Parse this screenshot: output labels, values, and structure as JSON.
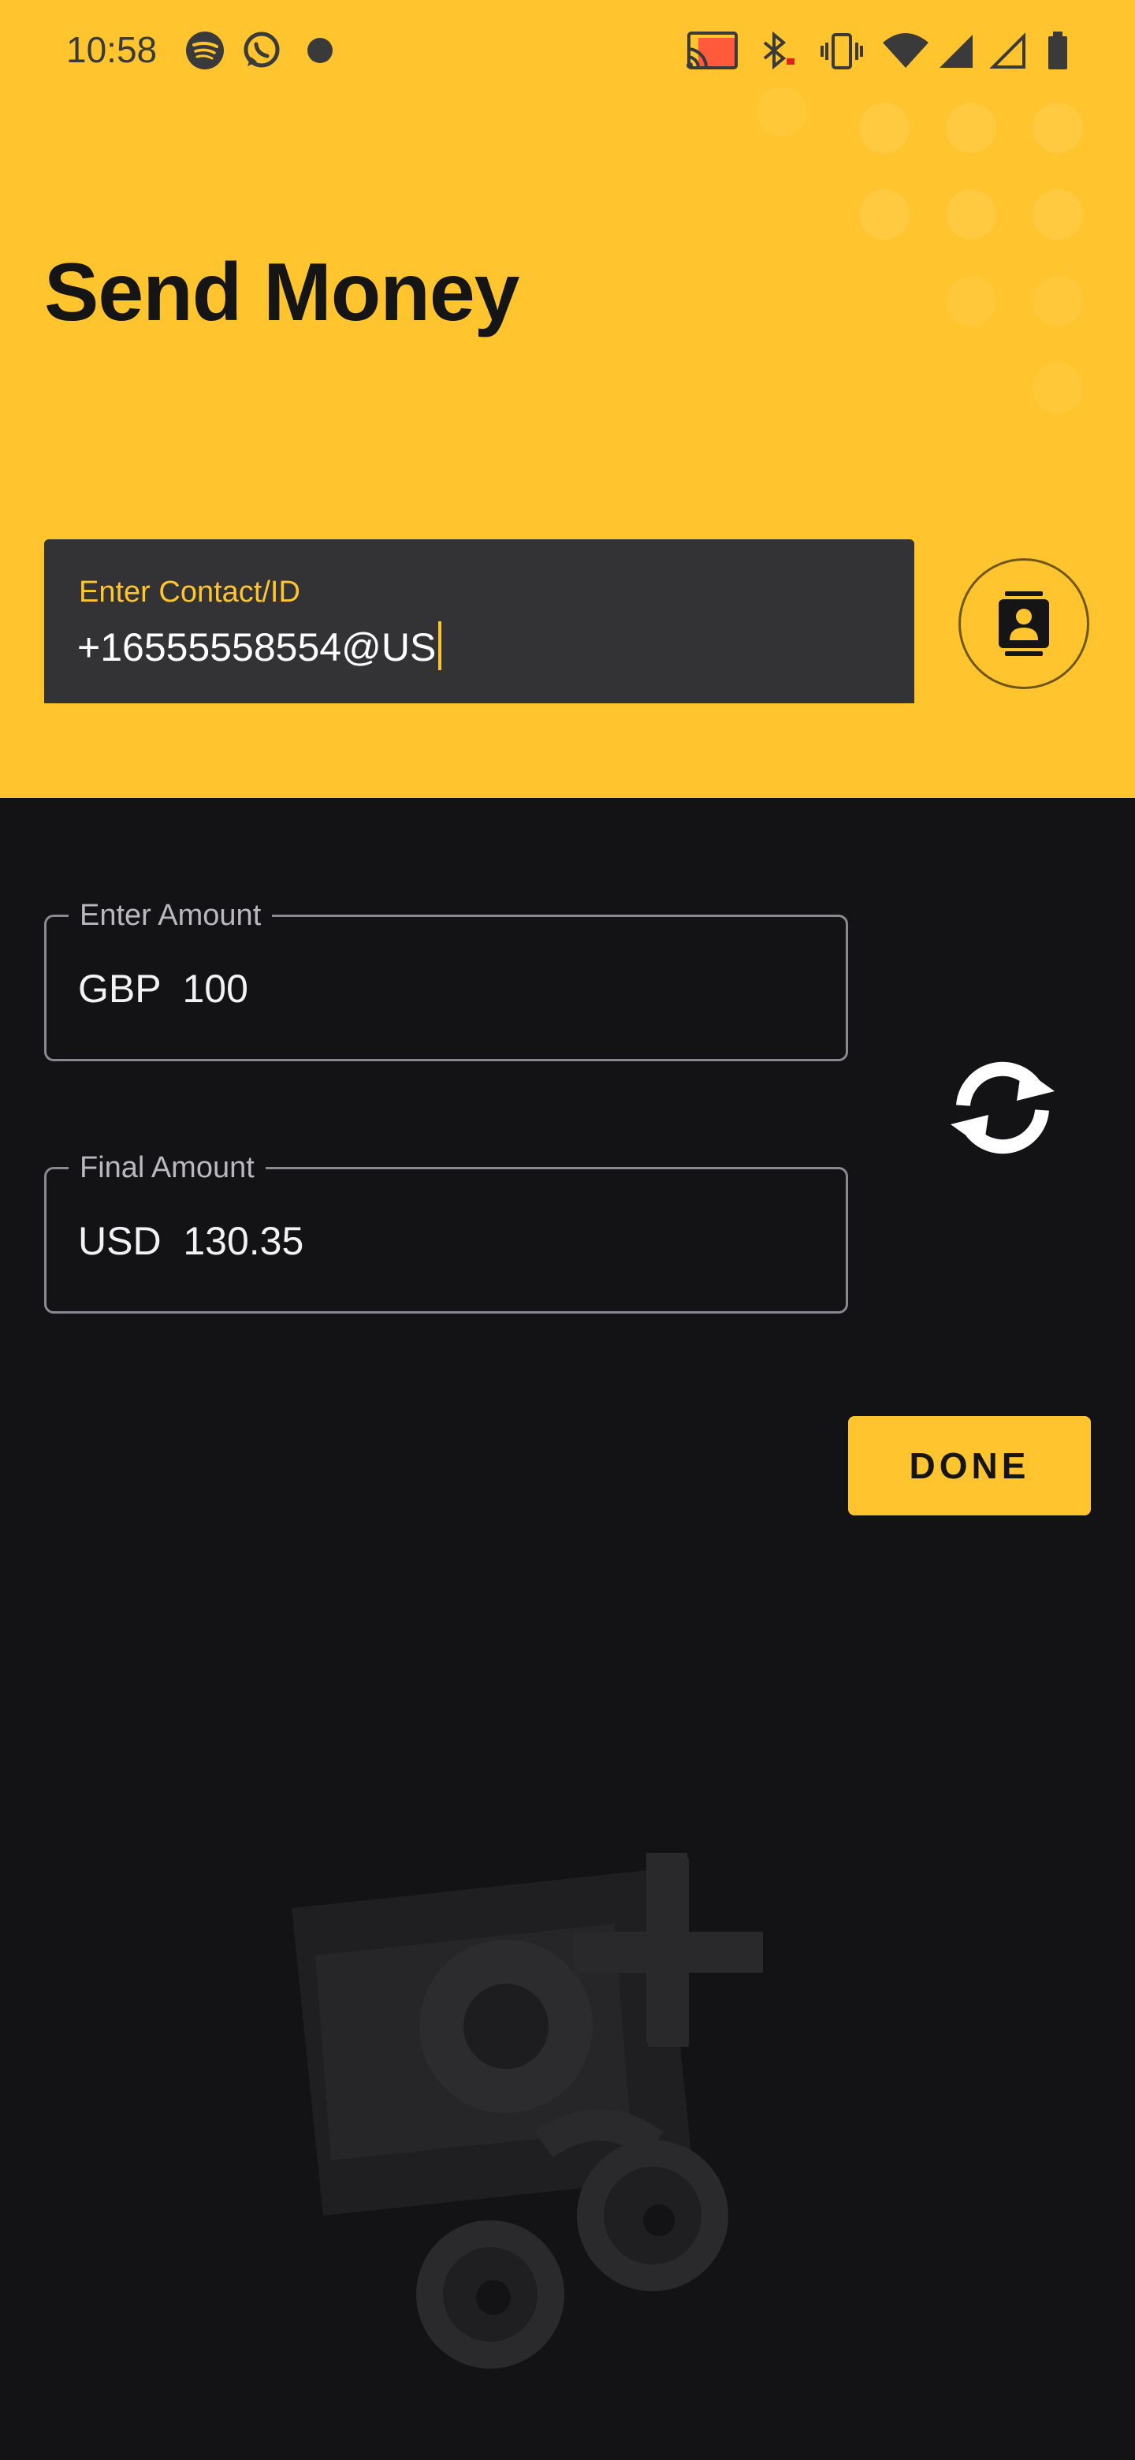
{
  "status_bar": {
    "time": "10:58",
    "left_icons": [
      "spotify-icon",
      "whatsapp-icon",
      "notification-dot-icon"
    ],
    "right_icons": [
      "cast-icon",
      "bluetooth-icon",
      "vibrate-icon",
      "wifi-icon",
      "signal-icon",
      "signal-empty-icon",
      "battery-icon"
    ]
  },
  "header": {
    "title": "Send Money"
  },
  "contact": {
    "label": "Enter Contact/ID",
    "value": "+16555558554@US",
    "button_icon": "contacts-book-icon"
  },
  "amount": {
    "label": "Enter Amount",
    "currency": "GBP",
    "value": "100",
    "display": "GBP  100"
  },
  "final_amount": {
    "label": "Final Amount",
    "currency": "USD",
    "value": "130.35",
    "display": "USD  130.35"
  },
  "swap_icon": "swap-refresh-icon",
  "done_label": "DONE",
  "colors": {
    "accent": "#ffc42e",
    "background": "#131315",
    "field": "#333335"
  }
}
